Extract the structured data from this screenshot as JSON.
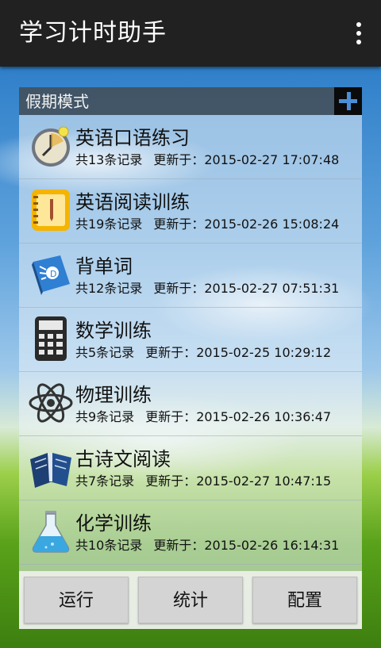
{
  "app": {
    "title": "学习计时助手",
    "menu_icon": "overflow-menu-icon"
  },
  "section": {
    "title": "假期模式",
    "add_icon": "plus-icon"
  },
  "items": [
    {
      "name": "英语口语练习",
      "count": "共13条记录",
      "updated": "更新于：2015-02-27 17:07:48",
      "icon": "stopwatch-icon"
    },
    {
      "name": "英语阅读训练",
      "count": "共19条记录",
      "updated": "更新于：2015-02-26 15:08:24",
      "icon": "notebook-icon"
    },
    {
      "name": "背单词",
      "count": "共12条记录",
      "updated": "更新于：2015-02-27 07:51:31",
      "icon": "dictionary-icon"
    },
    {
      "name": "数学训练",
      "count": "共5条记录",
      "updated": "更新于：2015-02-25 10:29:12",
      "icon": "calculator-icon"
    },
    {
      "name": "物理训练",
      "count": "共9条记录",
      "updated": "更新于：2015-02-26 10:36:47",
      "icon": "atom-icon"
    },
    {
      "name": "古诗文阅读",
      "count": "共7条记录",
      "updated": "更新于：2015-02-27 10:47:15",
      "icon": "book-icon"
    },
    {
      "name": "化学训练",
      "count": "共10条记录",
      "updated": "更新于：2015-02-26 16:14:31",
      "icon": "flask-icon"
    }
  ],
  "buttons": {
    "run": "运行",
    "stats": "统计",
    "config": "配置"
  }
}
